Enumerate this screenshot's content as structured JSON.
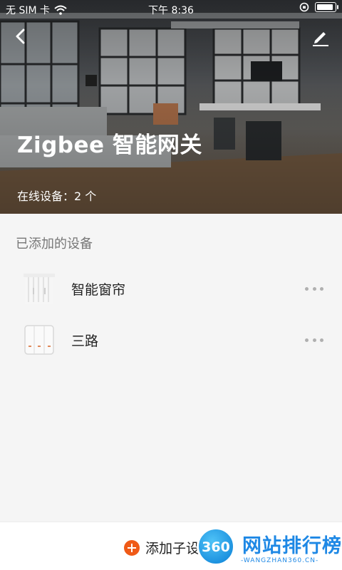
{
  "status_bar": {
    "carrier": "无 SIM 卡",
    "time": "下午 8:36"
  },
  "header": {
    "title": "Zigbee 智能网关",
    "online_devices": "在线设备：2 个",
    "back_icon": "chevron-left-icon",
    "edit_icon": "pencil-icon"
  },
  "devices": {
    "section_title": "已添加的设备",
    "items": [
      {
        "name": "智能窗帘",
        "icon": "curtain-icon"
      },
      {
        "name": "三路",
        "icon": "three-gang-switch-icon"
      }
    ]
  },
  "bottom_bar": {
    "add_label": "添加子设备",
    "accent_color": "#ef5a17"
  },
  "watermark": {
    "badge": "360",
    "name": "网站排行榜",
    "url": "-WANGZHAN360.CN-"
  }
}
